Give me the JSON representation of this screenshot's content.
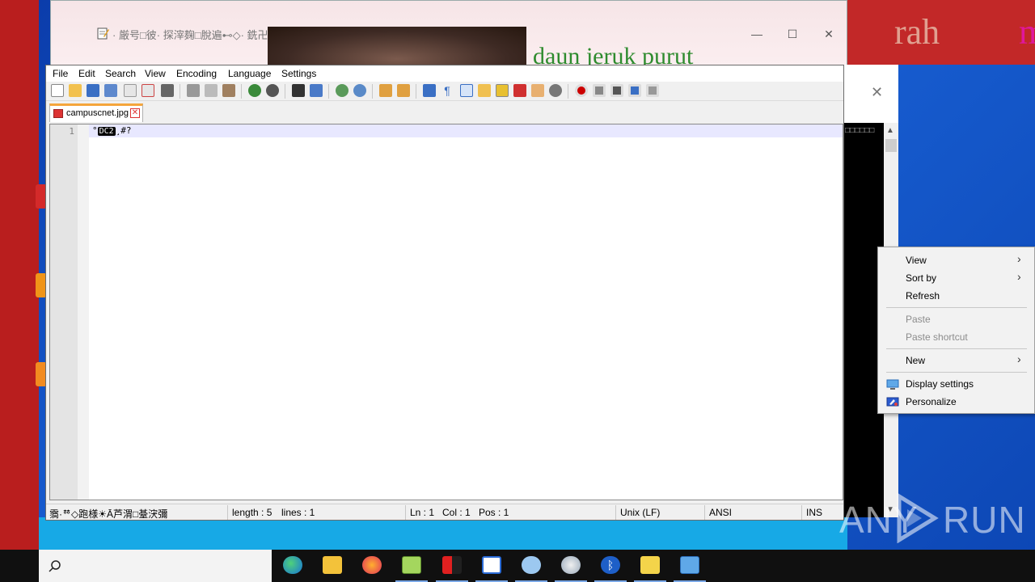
{
  "background_window": {
    "title": "· 厳号□彼· 探滓麹□脫遍⊷◇· 銑卍 肖　　　　　　　　　　　　　　　　　　　 Ā",
    "green_text": "daun jeruk purut",
    "controls": [
      "—",
      "☐",
      "✕"
    ]
  },
  "desktop_overlay_text": {
    "red_word": "rah",
    "magenta_letter": "m"
  },
  "console_text": "□□□□□□",
  "notepadpp": {
    "menu": [
      "File",
      "Edit",
      "Search",
      "View",
      "Encoding",
      "Language",
      "Settings"
    ],
    "tab": {
      "label": "campuscnet.jpg",
      "close": "✕"
    },
    "editor": {
      "line_number": "1",
      "prefix": "°",
      "control_char": "DC2",
      "suffix": "¸#?"
    },
    "status": {
      "doc_type": "霘·ᅘ◇跑様☀Ā芦渭□䑓涋彌",
      "length": "length : 5",
      "lines": "lines : 1",
      "ln": "Ln : 1",
      "col": "Col : 1",
      "pos": "Pos : 1",
      "eol": "Unix (LF)",
      "encoding": "ANSI",
      "mode": "INS"
    }
  },
  "context_menu": {
    "items": [
      {
        "label": "View",
        "submenu": true,
        "disabled": false
      },
      {
        "label": "Sort by",
        "submenu": true,
        "disabled": false
      },
      {
        "label": "Refresh",
        "submenu": false,
        "disabled": false
      },
      {
        "label": "Paste",
        "submenu": false,
        "disabled": true
      },
      {
        "label": "Paste shortcut",
        "submenu": false,
        "disabled": true
      },
      {
        "label": "New",
        "submenu": true,
        "disabled": false
      },
      {
        "label": "Display settings",
        "submenu": false,
        "disabled": false,
        "icon": "display-icon"
      },
      {
        "label": "Personalize",
        "submenu": false,
        "disabled": false,
        "icon": "personalize-icon"
      }
    ]
  },
  "watermark": {
    "left": "ANY",
    "right": "RUN"
  },
  "taskbar": {
    "apps": [
      "edge-icon",
      "file-explorer-icon",
      "firefox-icon",
      "notepadpp-icon",
      "network-icon",
      "news-icon",
      "globe-network-icon",
      "paint-icon",
      "bluetooth-icon",
      "hand-icon",
      "control-panel-icon"
    ]
  },
  "colors": {
    "desktop_blue": "#1a63d8",
    "red_wallpaper": "#b91e1e",
    "tab_accent": "#f5a53c",
    "line_highlight": "#e8e8ff"
  }
}
